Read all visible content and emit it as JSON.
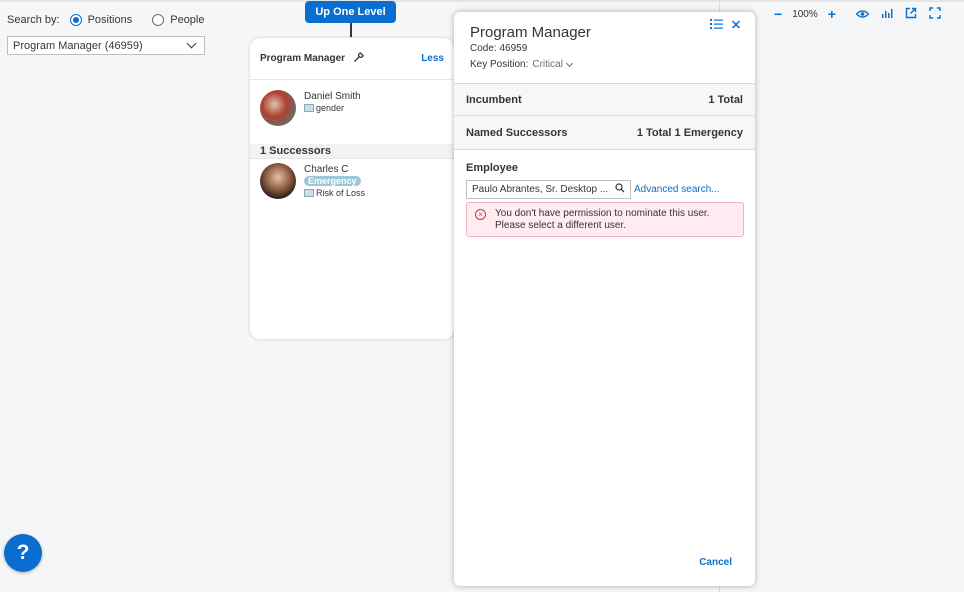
{
  "search": {
    "label": "Search by:",
    "options": [
      {
        "label": "Positions",
        "selected": true
      },
      {
        "label": "People",
        "selected": false
      }
    ],
    "selected_value": "Program Manager (46959)"
  },
  "up_one_level": "Up One Level",
  "position_card": {
    "title": "Program Manager",
    "less_label": "Less",
    "incumbent": {
      "name": "Daniel Smith",
      "sub": "gender"
    },
    "successors_header": "1 Successors",
    "successor": {
      "name": "Charles C",
      "badge": "Emergency",
      "sub": "Risk of Loss"
    }
  },
  "panel": {
    "title": "Program Manager",
    "code_label": "Code:",
    "code_value": "46959",
    "key_label": "Key Position:",
    "key_value": "Critical",
    "incumbent_label": "Incumbent",
    "incumbent_total": "1 Total",
    "named_label": "Named Successors",
    "named_total": "1 Total 1 Emergency",
    "employee_label": "Employee",
    "employee_value": "Paulo Abrantes, Sr. Desktop ...",
    "advanced_search": "Advanced search...",
    "error_line1": "You don't have permission to nominate this user.",
    "error_line2": "Please select a different user.",
    "cancel_label": "Cancel"
  },
  "toolbar": {
    "zoom": "100%"
  },
  "help_label": "?",
  "colors": {
    "accent": "#0a6ed1",
    "error_bg": "#ffebf0",
    "error": "#d0354b"
  }
}
